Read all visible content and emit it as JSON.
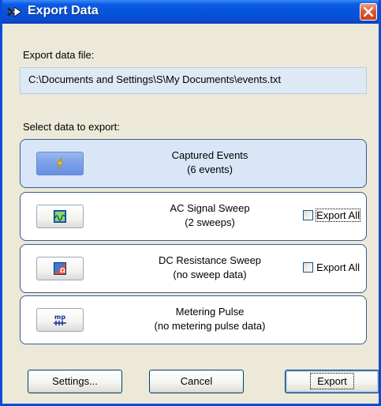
{
  "window": {
    "title": "Export Data",
    "icon": "export-arrow-icon",
    "titlebar_color": "#0553d8",
    "close_color": "#e05a34"
  },
  "file": {
    "label": "Export data file:",
    "path": "C:\\Documents and Settings\\S\\My Documents\\events.txt"
  },
  "select_label": "Select data to export:",
  "items": [
    {
      "title": "Captured Events",
      "subtitle": "(6 events)",
      "icon": "lightning-icon",
      "selected": true
    },
    {
      "title": "AC Signal Sweep",
      "subtitle": "(2 sweeps)",
      "icon": "ac-sweep-icon",
      "export_all": "Export All",
      "export_all_checked": false
    },
    {
      "title": "DC Resistance Sweep",
      "subtitle": "(no sweep data)",
      "icon": "dc-resistance-icon",
      "export_all": "Export All",
      "export_all_checked": false
    },
    {
      "title": "Metering Pulse",
      "subtitle": "(no metering pulse data)",
      "icon": "metering-pulse-icon",
      "icon_text": "mp"
    }
  ],
  "buttons": {
    "settings": "Settings...",
    "cancel": "Cancel",
    "export": "Export"
  }
}
